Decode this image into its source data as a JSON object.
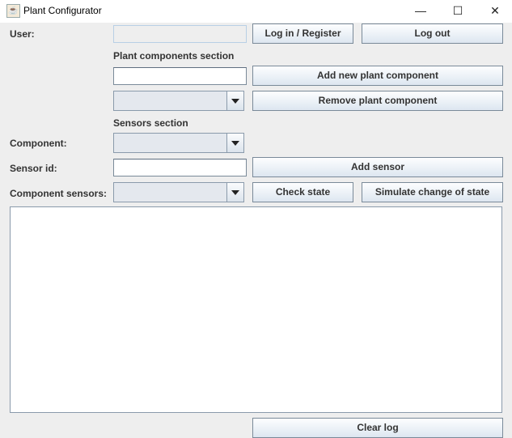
{
  "window": {
    "title": "Plant Configurator",
    "minimize": "—",
    "maximize": "☐",
    "close": "✕",
    "icon": "java-cup-icon"
  },
  "user": {
    "label": "User:",
    "value": "",
    "login_label": "Log in / Register",
    "logout_label": "Log out"
  },
  "plant": {
    "section_label": "Plant components section",
    "name_value": "",
    "add_label": "Add new plant component",
    "combo_value": "",
    "remove_label": "Remove plant component"
  },
  "sensors": {
    "section_label": "Sensors section",
    "component_label": "Component:",
    "component_value": "",
    "sensor_id_label": "Sensor id:",
    "sensor_id_value": "",
    "add_sensor_label": "Add sensor",
    "component_sensors_label": "Component sensors:",
    "component_sensors_value": "",
    "check_state_label": "Check state",
    "simulate_label": "Simulate change of state"
  },
  "log": {
    "text": "",
    "clear_label": "Clear log"
  }
}
